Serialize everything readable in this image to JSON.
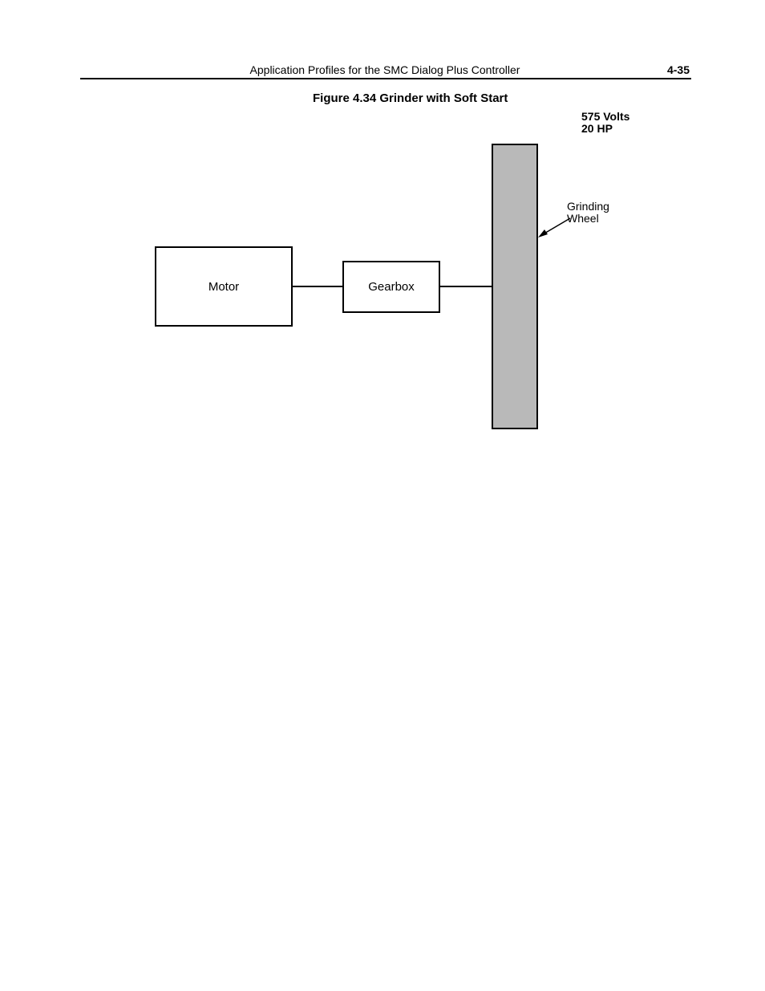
{
  "header": {
    "title": "Application Profiles for the SMC Dialog Plus Controller",
    "page_number": "4-35"
  },
  "figure": {
    "caption": "Figure 4.34 Grinder with Soft Start",
    "spec_line1": "575 Volts",
    "spec_line2": "20 HP",
    "motor_label": "Motor",
    "gearbox_label": "Gearbox",
    "wheel_label_line1": "Grinding",
    "wheel_label_line2": "Wheel"
  }
}
